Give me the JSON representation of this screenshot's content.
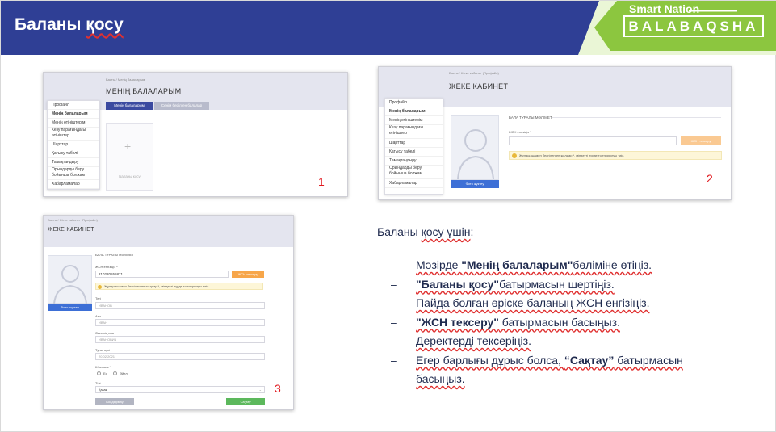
{
  "header": {
    "title_part1": "Баланы ",
    "title_part2": "қосу"
  },
  "logo": {
    "smart": "Smart Nation",
    "brand": "BALABAQSHA"
  },
  "shot1": {
    "crumb": "Басты  /  Менің балаларым",
    "title": "МЕНІҢ БАЛАЛАРЫМ",
    "tab_active": "Менің балаларым",
    "tab_inactive": "Сенім берілген балалар",
    "add_child": "Баланы қосу",
    "sidebar": [
      "Профайл",
      "Менің балаларым",
      "Менің өтініштерім",
      "Кезу парағындағы өтініштер",
      "Шарттар",
      "Қатысу табелі",
      "Тамақтандыру",
      "Орындарды беру бойынша болжам",
      "Хабарламалар"
    ],
    "number": "1"
  },
  "shot2": {
    "crumb": "Басты  /  Жеке кабинет (Профайл)",
    "title": "ЖЕКЕ КАБИНЕТ",
    "section": "БАЛА ТУРАЛЫ МӘЛІМЕТ",
    "iin_label": "ЖСН енгізіңіз *",
    "check_btn": "ЖСН тексеру",
    "note": "Жұлдызшамен белгіленген жолдар *, міндетті түрде толтырылуы тиіс.",
    "photo_btn": "Фото жүктеу",
    "sidebar": [
      "Профайл",
      "Менің балаларым",
      "Менің өтініштерім",
      "Кезу парағындағы өтініштер",
      "Шарттар",
      "Қатысу табелі",
      "Тамақтандыру",
      "Орындарды беру бойынша болжам",
      "Хабарламалар"
    ],
    "number": "2"
  },
  "shot3": {
    "crumb": "Басты  /  Жеке кабинет (Профайл)",
    "title": "ЖЕКЕ КАБИНЕТ",
    "section": "БАЛА ТУРАЛЫ МӘЛІМЕТ",
    "iin_label": "ЖСН енгізіңіз *",
    "iin_value": "210220555871",
    "check_btn": "ЖСН тексеру",
    "note": "Жұлдызшамен белгіленген жолдар *, міндетті түрде толтырылуы тиіс.",
    "photo_btn": "Фото жүктеу",
    "surname_label": "Тегі",
    "surname": "ИВАНОВ",
    "name_label": "Аты",
    "name": "ИВАН",
    "patronymic_label": "Әкесінің аты",
    "patronymic": "ИВАНОВИЧ",
    "birth_label": "Туған күні",
    "birth": "20.02.2021",
    "gender_label": "Жынысы *",
    "gender_m": "Ер",
    "gender_f": "Әйел",
    "lang_label": "Тілі",
    "lang": "Қазақ",
    "back_btn": "Болдырмау",
    "save_btn": "Сақтау",
    "number": "3"
  },
  "instructions": {
    "intro_a": "Баланы ",
    "intro_b": "қосу үшін",
    "intro_c": ":",
    "steps": [
      {
        "pre": "Мәзірде ",
        "bold": "\"Менің балаларым\"",
        "post": "бөліміне өтіңіз."
      },
      {
        "pre": "",
        "bold": "\"Баланы қосу\"",
        "post": "батырмасын шертіңіз."
      },
      {
        "pre": "Пайда болған өріске баланың ЖСН енгізіңіз.",
        "bold": "",
        "post": ""
      },
      {
        "pre": "",
        "bold": "\"ЖСН тексеру\"",
        "post": " батырмасын басыңыз."
      },
      {
        "pre": "Деректерді тексеріңіз.",
        "bold": "",
        "post": ""
      },
      {
        "pre": "Егер барлығы дұрыс болса, ",
        "bold": "“Сақтау”",
        "post": " батырмасын басыңыз."
      }
    ]
  }
}
